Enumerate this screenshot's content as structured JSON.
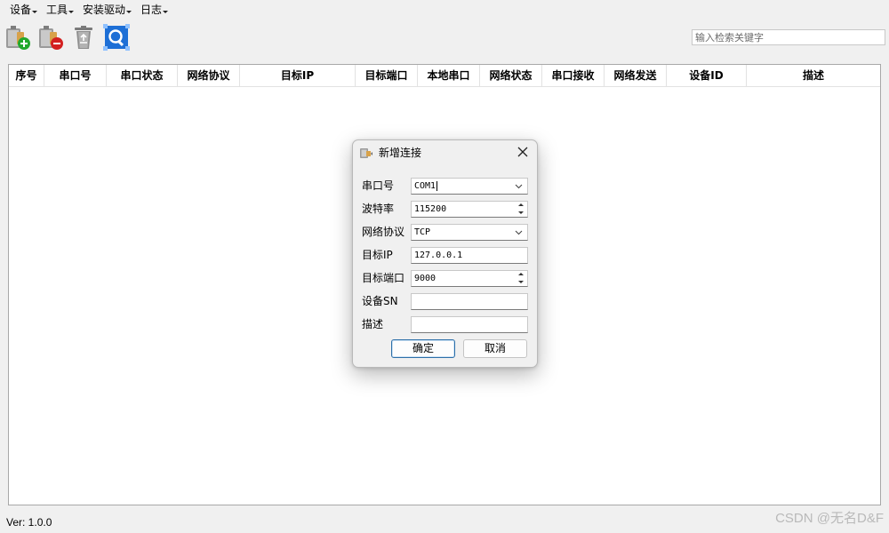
{
  "menubar": {
    "items": [
      {
        "label": "设备"
      },
      {
        "label": "工具"
      },
      {
        "label": "安装驱动"
      },
      {
        "label": "日志"
      }
    ]
  },
  "toolbar": {
    "buttons": [
      {
        "icon": "add-device-icon"
      },
      {
        "icon": "remove-device-icon"
      },
      {
        "icon": "recycle-bin-icon"
      },
      {
        "icon": "scan-icon"
      }
    ],
    "search": {
      "placeholder": "输入检索关键字",
      "value": ""
    }
  },
  "table": {
    "columns": [
      "序号",
      "串口号",
      "串口状态",
      "网络协议",
      "目标IP",
      "目标端口",
      "本地串口",
      "网络状态",
      "串口接收",
      "网络发送",
      "设备ID",
      "描述"
    ],
    "rows": []
  },
  "status": {
    "version": "Ver: 1.0.0"
  },
  "watermark": "CSDN @无名D&F",
  "dialog": {
    "title": "新增连接",
    "fields": [
      {
        "label": "串口号",
        "value": "COM1",
        "type": "combo"
      },
      {
        "label": "波特率",
        "value": "115200",
        "type": "spin"
      },
      {
        "label": "网络协议",
        "value": "TCP",
        "type": "combo"
      },
      {
        "label": "目标IP",
        "value": "127.0.0.1",
        "type": "text"
      },
      {
        "label": "目标端口",
        "value": "9000",
        "type": "spin"
      },
      {
        "label": "设备SN",
        "value": "",
        "type": "text"
      },
      {
        "label": "描述",
        "value": "",
        "type": "text"
      }
    ],
    "ok_label": "确定",
    "cancel_label": "取消"
  },
  "colors": {
    "window_bg": "#f0f0f0",
    "table_bg": "#ffffff",
    "primary_button_border": "#2d6fa8",
    "add_icon_green": "#22a82c",
    "remove_icon_red": "#d32020",
    "scan_icon_blue": "#1d6fd6"
  }
}
